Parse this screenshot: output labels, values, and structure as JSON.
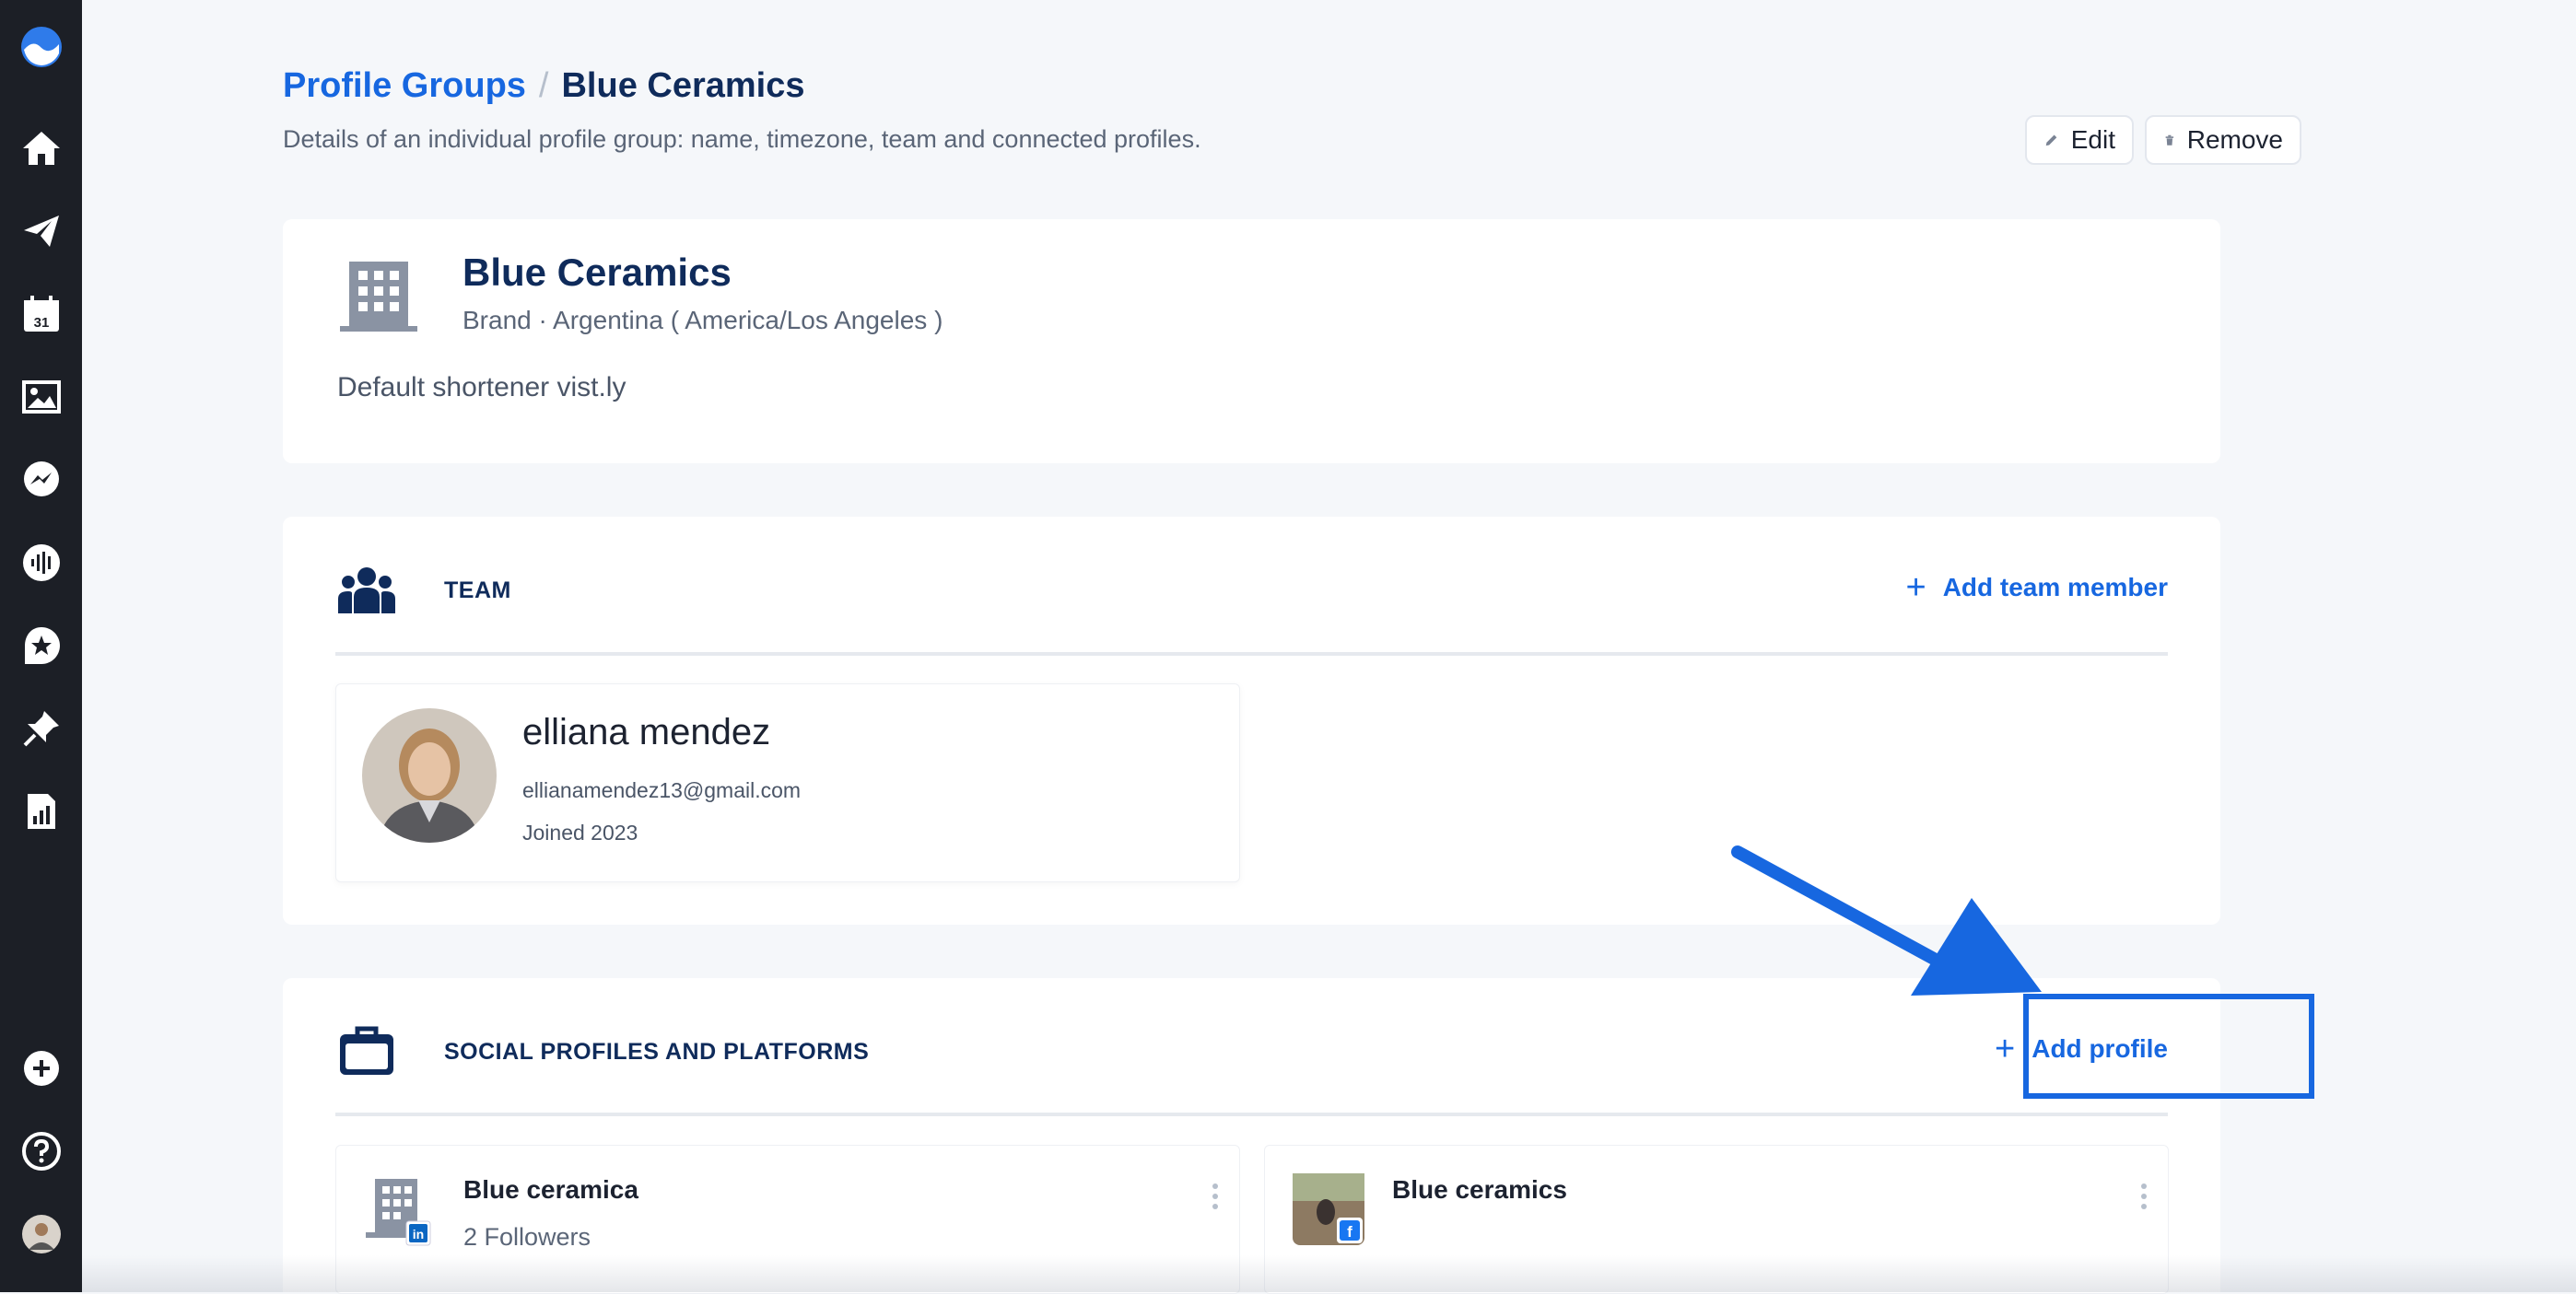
{
  "breadcrumb": {
    "parent": "Profile Groups",
    "separator": "/",
    "current": "Blue Ceramics"
  },
  "page": {
    "subtitle": "Details of an individual profile group: name, timezone, team and connected profiles."
  },
  "actions": {
    "edit_label": "Edit",
    "remove_label": "Remove"
  },
  "group": {
    "name": "Blue Ceramics",
    "meta": "Brand · Argentina ( America/Los Angeles )",
    "shortener": "Default shortener vist.ly"
  },
  "team": {
    "title": "TEAM",
    "add_label": "Add team member",
    "members": [
      {
        "name": "elliana mendez",
        "email": "ellianamendez13@gmail.com",
        "joined": "Joined 2023"
      }
    ]
  },
  "social": {
    "title": "SOCIAL PROFILES AND PLATFORMS",
    "add_label": "Add profile",
    "profiles": [
      {
        "name": "Blue ceramica",
        "followers": "2 Followers",
        "network": "linkedin"
      },
      {
        "name": "Blue ceramics",
        "followers": "",
        "network": "facebook"
      }
    ]
  },
  "sidebar": {
    "icons": [
      "logo-icon",
      "home-icon",
      "send-icon",
      "calendar-icon",
      "image-icon",
      "messenger-icon",
      "audio-icon",
      "star-badge-icon",
      "pin-icon",
      "report-icon",
      "add-icon",
      "help-icon",
      "user-avatar"
    ]
  },
  "colors": {
    "accent": "#1767e0",
    "navy": "#0f2b5b",
    "sidebar": "#1c1f26",
    "background": "#f5f7fa"
  }
}
